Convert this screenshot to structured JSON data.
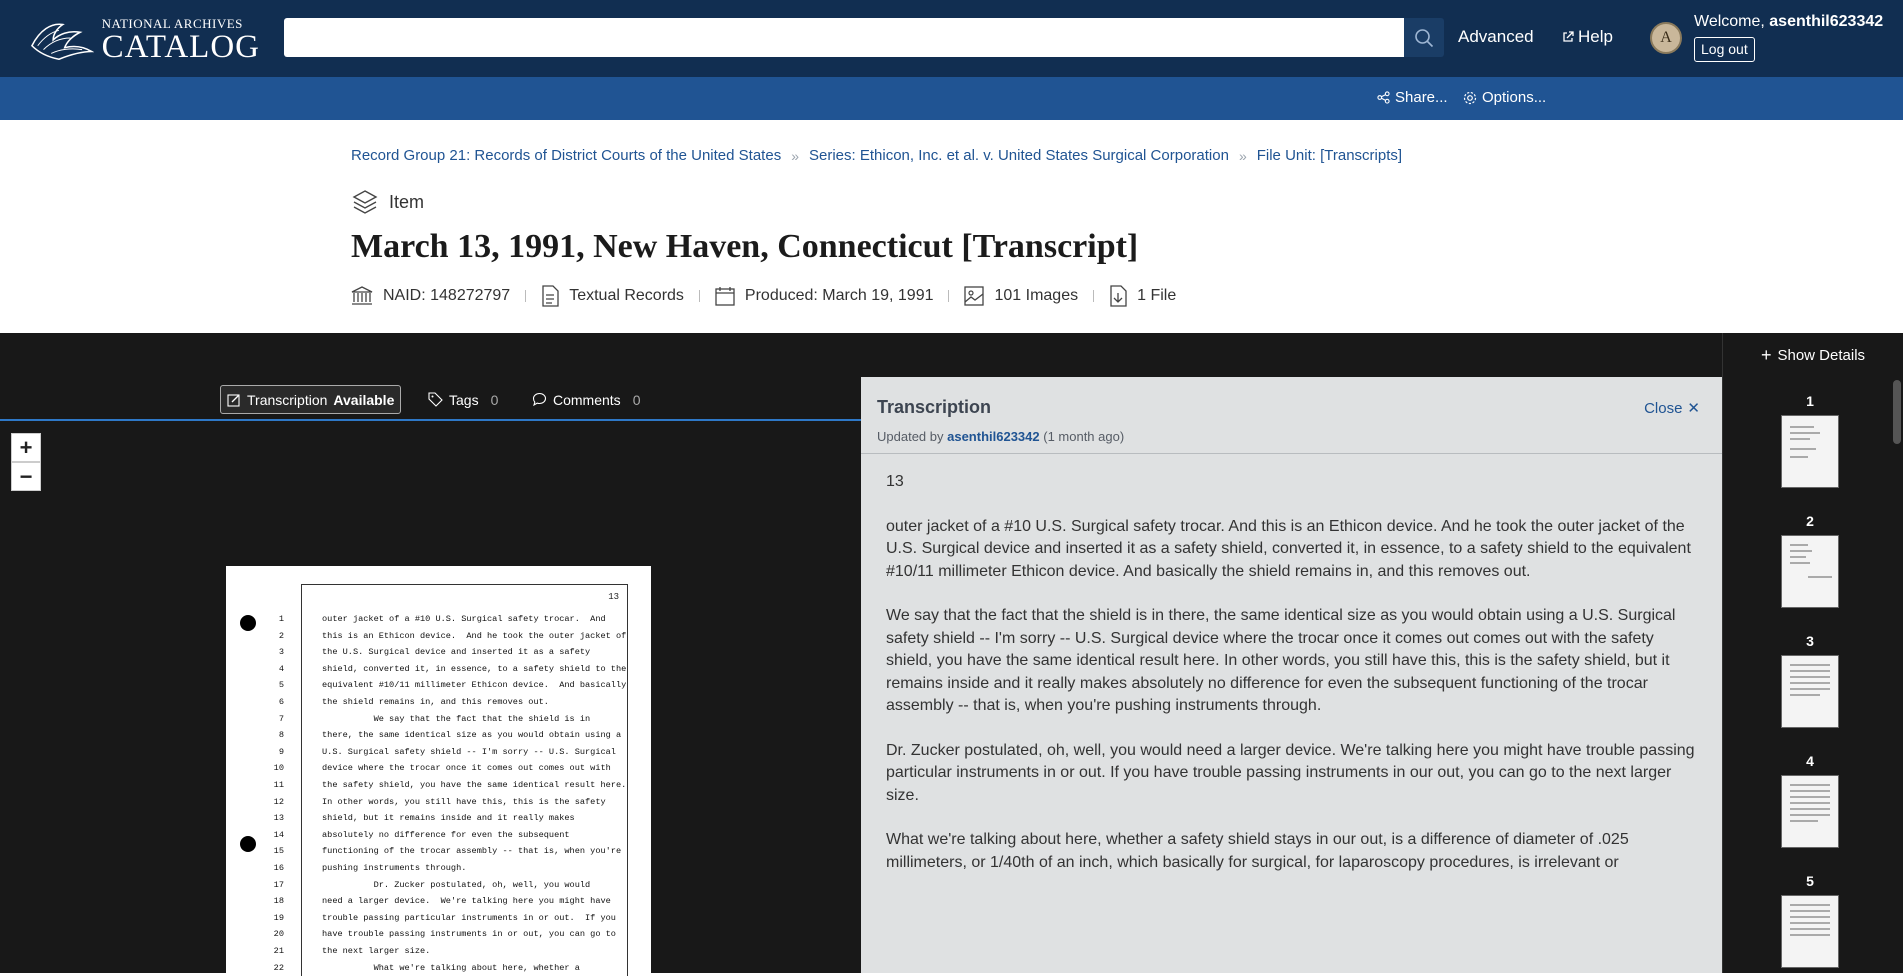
{
  "header": {
    "logo_top": "NATIONAL ARCHIVES",
    "logo_main": "CATALOG",
    "search_value": "",
    "advanced_label": "Advanced",
    "help_label": "Help",
    "avatar_initial": "A",
    "welcome_prefix": "Welcome, ",
    "username": "asenthil623342",
    "logout_label": "Log out"
  },
  "subbar": {
    "share_label": "Share...",
    "options_label": "Options..."
  },
  "breadcrumb": [
    "Record Group 21: Records of District Courts of the United States",
    "Series: Ethicon, Inc. et al. v. United States Surgical Corporation",
    "File Unit: [Transcripts]"
  ],
  "record": {
    "level": "Item",
    "title": "March 13, 1991, New Haven, Connecticut [Transcript]",
    "naid": "NAID: 148272797",
    "type": "Textual Records",
    "produced": "Produced: March 19, 1991",
    "images": "101 Images",
    "files": "1 File"
  },
  "viewer": {
    "show_details": "Show Details",
    "tabs": {
      "transcription": "Transcription",
      "transcription_status": "Available",
      "tags": "Tags",
      "tags_count": "0",
      "comments": "Comments",
      "comments_count": "0"
    },
    "zoom_in": "+",
    "zoom_out": "−",
    "doc_page_number": "13",
    "doc_lines": [
      "outer jacket of a #10 U.S. Surgical safety trocar.  And",
      "this is an Ethicon device.  And he took the outer jacket of",
      "the U.S. Surgical device and inserted it as a safety",
      "shield, converted it, in essence, to a safety shield to the",
      "equivalent #10/11 millimeter Ethicon device.  And basically",
      "the shield remains in, and this removes out.",
      "          We say that the fact that the shield is in",
      "there, the same identical size as you would obtain using a",
      "U.S. Surgical safety shield -- I'm sorry -- U.S. Surgical",
      "device where the trocar once it comes out comes out with",
      "the safety shield, you have the same identical result here.",
      "In other words, you still have this, this is the safety",
      "shield, but it remains inside and it really makes",
      "absolutely no difference for even the subsequent",
      "functioning of the trocar assembly -- that is, when you're",
      "pushing instruments through.",
      "          Dr. Zucker postulated, oh, well, you would",
      "need a larger device.  We're talking here you might have",
      "trouble passing particular instruments in or out.  If you",
      "have trouble passing instruments in or out, you can go to",
      "the next larger size.",
      "          What we're talking about here, whether a"
    ],
    "doc_line_numbers": [
      "1",
      "2",
      "3",
      "4",
      "5",
      "6",
      "7",
      "8",
      "9",
      "10",
      "11",
      "12",
      "13",
      "14",
      "15",
      "16",
      "17",
      "18",
      "19",
      "20",
      "21",
      "22"
    ]
  },
  "transcription": {
    "title": "Transcription",
    "updated_prefix": "Updated by ",
    "updated_user": "asenthil623342",
    "updated_suffix": " (1 month ago)",
    "close_label": "Close",
    "paragraphs": [
      "13",
      "outer jacket of a #10 U.S. Surgical safety trocar. And this is an Ethicon device. And he took the outer jacket of the U.S. Surgical device and inserted it as a safety shield, converted it, in essence, to a safety shield to the equivalent #10/11 millimeter Ethicon device. And basically the shield remains in, and this removes out.",
      "We say that the fact that the shield is in there, the same identical size as you would obtain using a U.S. Surgical safety shield -- I'm sorry -- U.S. Surgical device where the trocar once it comes out comes out with the safety shield, you have the same identical result here. In other words, you still have this, this is the safety shield, but it remains inside and it really makes absolutely no difference for even the subsequent functioning of the trocar assembly -- that is, when you're pushing instruments through.",
      "Dr. Zucker postulated, oh, well, you would need a larger device. We're talking here you might have trouble passing particular instruments in or out. If you have trouble passing instruments in our out, you can go to the next larger size.",
      "What we're talking about here, whether a safety shield stays in our out, is a difference of diameter of .025 millimeters, or 1/40th of an inch, which basically for surgical, for laparoscopy procedures, is irrelevant or"
    ]
  },
  "thumbnails": [
    "1",
    "2",
    "3",
    "4",
    "5"
  ],
  "colors": {
    "topbar": "#112e51",
    "subbar": "#205493",
    "link": "#205493",
    "viewer_bg": "#181818",
    "panel_bg": "#dfe1e2"
  }
}
